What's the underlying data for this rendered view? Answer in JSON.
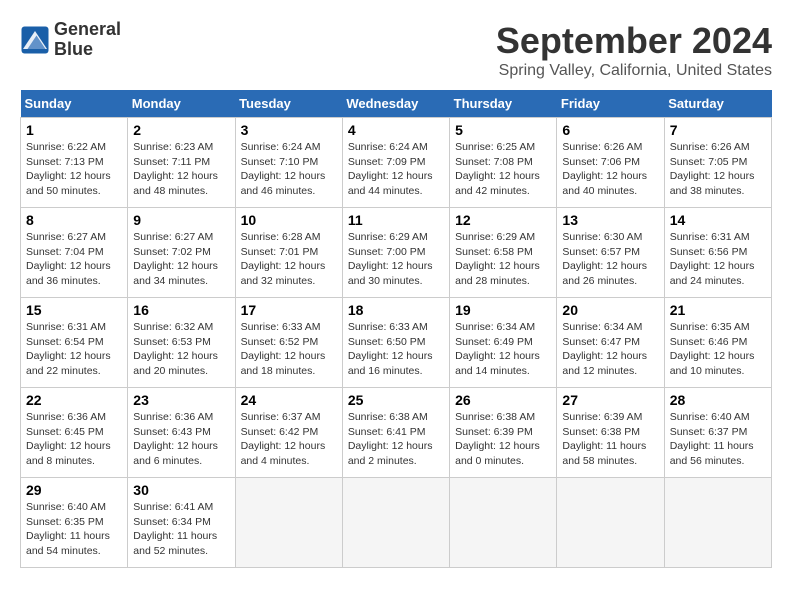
{
  "logo": {
    "line1": "General",
    "line2": "Blue"
  },
  "title": "September 2024",
  "subtitle": "Spring Valley, California, United States",
  "headers": [
    "Sunday",
    "Monday",
    "Tuesday",
    "Wednesday",
    "Thursday",
    "Friday",
    "Saturday"
  ],
  "weeks": [
    [
      {
        "day": "1",
        "info": "Sunrise: 6:22 AM\nSunset: 7:13 PM\nDaylight: 12 hours\nand 50 minutes."
      },
      {
        "day": "2",
        "info": "Sunrise: 6:23 AM\nSunset: 7:11 PM\nDaylight: 12 hours\nand 48 minutes."
      },
      {
        "day": "3",
        "info": "Sunrise: 6:24 AM\nSunset: 7:10 PM\nDaylight: 12 hours\nand 46 minutes."
      },
      {
        "day": "4",
        "info": "Sunrise: 6:24 AM\nSunset: 7:09 PM\nDaylight: 12 hours\nand 44 minutes."
      },
      {
        "day": "5",
        "info": "Sunrise: 6:25 AM\nSunset: 7:08 PM\nDaylight: 12 hours\nand 42 minutes."
      },
      {
        "day": "6",
        "info": "Sunrise: 6:26 AM\nSunset: 7:06 PM\nDaylight: 12 hours\nand 40 minutes."
      },
      {
        "day": "7",
        "info": "Sunrise: 6:26 AM\nSunset: 7:05 PM\nDaylight: 12 hours\nand 38 minutes."
      }
    ],
    [
      {
        "day": "8",
        "info": "Sunrise: 6:27 AM\nSunset: 7:04 PM\nDaylight: 12 hours\nand 36 minutes."
      },
      {
        "day": "9",
        "info": "Sunrise: 6:27 AM\nSunset: 7:02 PM\nDaylight: 12 hours\nand 34 minutes."
      },
      {
        "day": "10",
        "info": "Sunrise: 6:28 AM\nSunset: 7:01 PM\nDaylight: 12 hours\nand 32 minutes."
      },
      {
        "day": "11",
        "info": "Sunrise: 6:29 AM\nSunset: 7:00 PM\nDaylight: 12 hours\nand 30 minutes."
      },
      {
        "day": "12",
        "info": "Sunrise: 6:29 AM\nSunset: 6:58 PM\nDaylight: 12 hours\nand 28 minutes."
      },
      {
        "day": "13",
        "info": "Sunrise: 6:30 AM\nSunset: 6:57 PM\nDaylight: 12 hours\nand 26 minutes."
      },
      {
        "day": "14",
        "info": "Sunrise: 6:31 AM\nSunset: 6:56 PM\nDaylight: 12 hours\nand 24 minutes."
      }
    ],
    [
      {
        "day": "15",
        "info": "Sunrise: 6:31 AM\nSunset: 6:54 PM\nDaylight: 12 hours\nand 22 minutes."
      },
      {
        "day": "16",
        "info": "Sunrise: 6:32 AM\nSunset: 6:53 PM\nDaylight: 12 hours\nand 20 minutes."
      },
      {
        "day": "17",
        "info": "Sunrise: 6:33 AM\nSunset: 6:52 PM\nDaylight: 12 hours\nand 18 minutes."
      },
      {
        "day": "18",
        "info": "Sunrise: 6:33 AM\nSunset: 6:50 PM\nDaylight: 12 hours\nand 16 minutes."
      },
      {
        "day": "19",
        "info": "Sunrise: 6:34 AM\nSunset: 6:49 PM\nDaylight: 12 hours\nand 14 minutes."
      },
      {
        "day": "20",
        "info": "Sunrise: 6:34 AM\nSunset: 6:47 PM\nDaylight: 12 hours\nand 12 minutes."
      },
      {
        "day": "21",
        "info": "Sunrise: 6:35 AM\nSunset: 6:46 PM\nDaylight: 12 hours\nand 10 minutes."
      }
    ],
    [
      {
        "day": "22",
        "info": "Sunrise: 6:36 AM\nSunset: 6:45 PM\nDaylight: 12 hours\nand 8 minutes."
      },
      {
        "day": "23",
        "info": "Sunrise: 6:36 AM\nSunset: 6:43 PM\nDaylight: 12 hours\nand 6 minutes."
      },
      {
        "day": "24",
        "info": "Sunrise: 6:37 AM\nSunset: 6:42 PM\nDaylight: 12 hours\nand 4 minutes."
      },
      {
        "day": "25",
        "info": "Sunrise: 6:38 AM\nSunset: 6:41 PM\nDaylight: 12 hours\nand 2 minutes."
      },
      {
        "day": "26",
        "info": "Sunrise: 6:38 AM\nSunset: 6:39 PM\nDaylight: 12 hours\nand 0 minutes."
      },
      {
        "day": "27",
        "info": "Sunrise: 6:39 AM\nSunset: 6:38 PM\nDaylight: 11 hours\nand 58 minutes."
      },
      {
        "day": "28",
        "info": "Sunrise: 6:40 AM\nSunset: 6:37 PM\nDaylight: 11 hours\nand 56 minutes."
      }
    ],
    [
      {
        "day": "29",
        "info": "Sunrise: 6:40 AM\nSunset: 6:35 PM\nDaylight: 11 hours\nand 54 minutes."
      },
      {
        "day": "30",
        "info": "Sunrise: 6:41 AM\nSunset: 6:34 PM\nDaylight: 11 hours\nand 52 minutes."
      },
      {
        "day": "",
        "info": ""
      },
      {
        "day": "",
        "info": ""
      },
      {
        "day": "",
        "info": ""
      },
      {
        "day": "",
        "info": ""
      },
      {
        "day": "",
        "info": ""
      }
    ]
  ]
}
